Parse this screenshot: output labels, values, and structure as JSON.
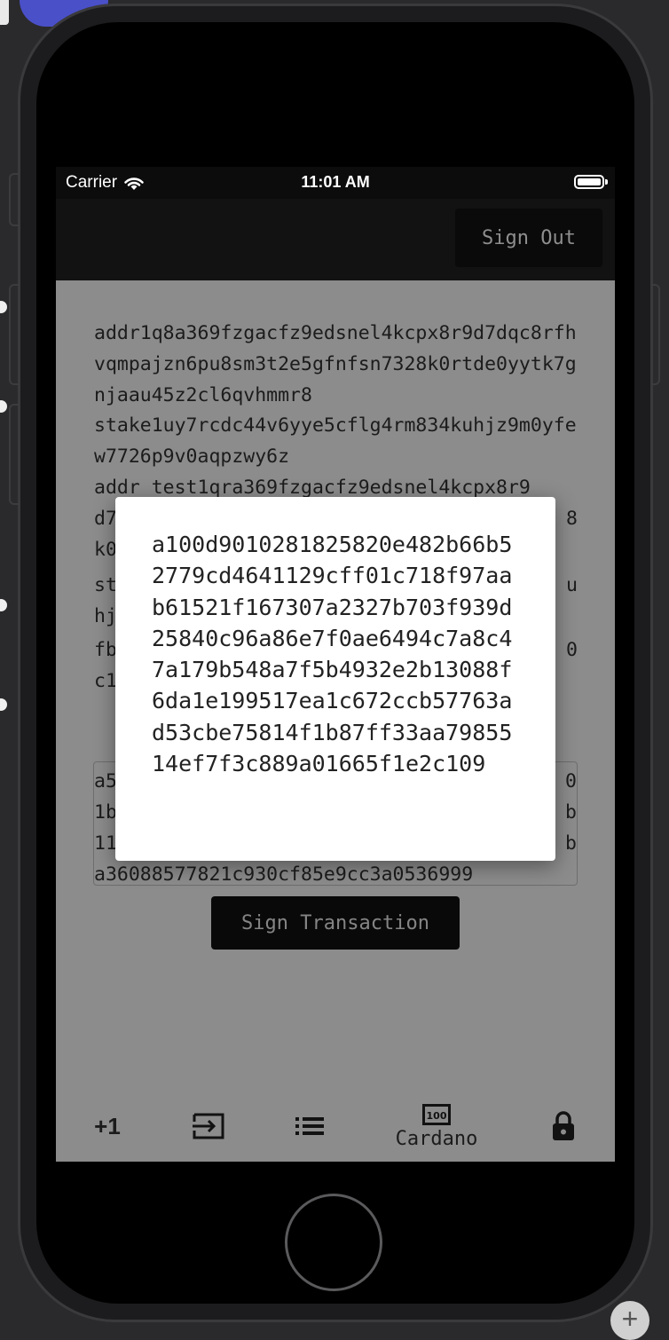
{
  "status_bar": {
    "carrier": "Carrier",
    "time": "11:01 AM"
  },
  "nav": {
    "sign_out_label": "Sign Out"
  },
  "addresses": {
    "base_address": "addr1q8a369fzgacfz9edsnel4kcpx8r9d7dqc8rfhvqmpajzn6pu8sm3t2e5gfnfsn7328k0rtde0yytk7gnjaau45z2cl6qvhmmr8",
    "stake_address": "stake1uy7rcdc44v6yye5cflg4rm834kuhjz9m0yfew7726p9v0aqpzwy6z",
    "test_address_visible_lines": [
      "addr_test1qra369fzgacfz9edsnel4kcpx8r9",
      "d7",
      "8",
      "k0"
    ],
    "stake_test_visible_lines": [
      "st",
      "u",
      "hj"
    ],
    "hash_visible_lines": [
      "fb",
      "0",
      "c1"
    ]
  },
  "transaction": {
    "visible_lines_left": [
      "a5",
      "1b",
      "11"
    ],
    "visible_lines_right": [
      "0",
      "b",
      "b"
    ],
    "last_line": "a36088577821c930cf85e9cc3a0536999",
    "sign_label": "Sign Transaction"
  },
  "tabs": [
    {
      "icon": "plus-one-icon",
      "label": "+1"
    },
    {
      "icon": "input-icon",
      "label": ""
    },
    {
      "icon": "list-icon",
      "label": ""
    },
    {
      "icon": "cardano-icon",
      "label": "Cardano"
    },
    {
      "icon": "lock-icon",
      "label": ""
    }
  ],
  "dialog": {
    "signed_tx_hex": "a100d9010281825820e482b66b52779cd4641129cff01c718f97aab61521f167307a2327b703f939d25840c96a86e7f0ae6494c7a8c47a179b548a7f5b4932e2b13088f6da1e199517ea1c672ccb57763ad53cbe75814f1b87ff33aa7985514ef7f3c889a01665f1e2c109"
  }
}
